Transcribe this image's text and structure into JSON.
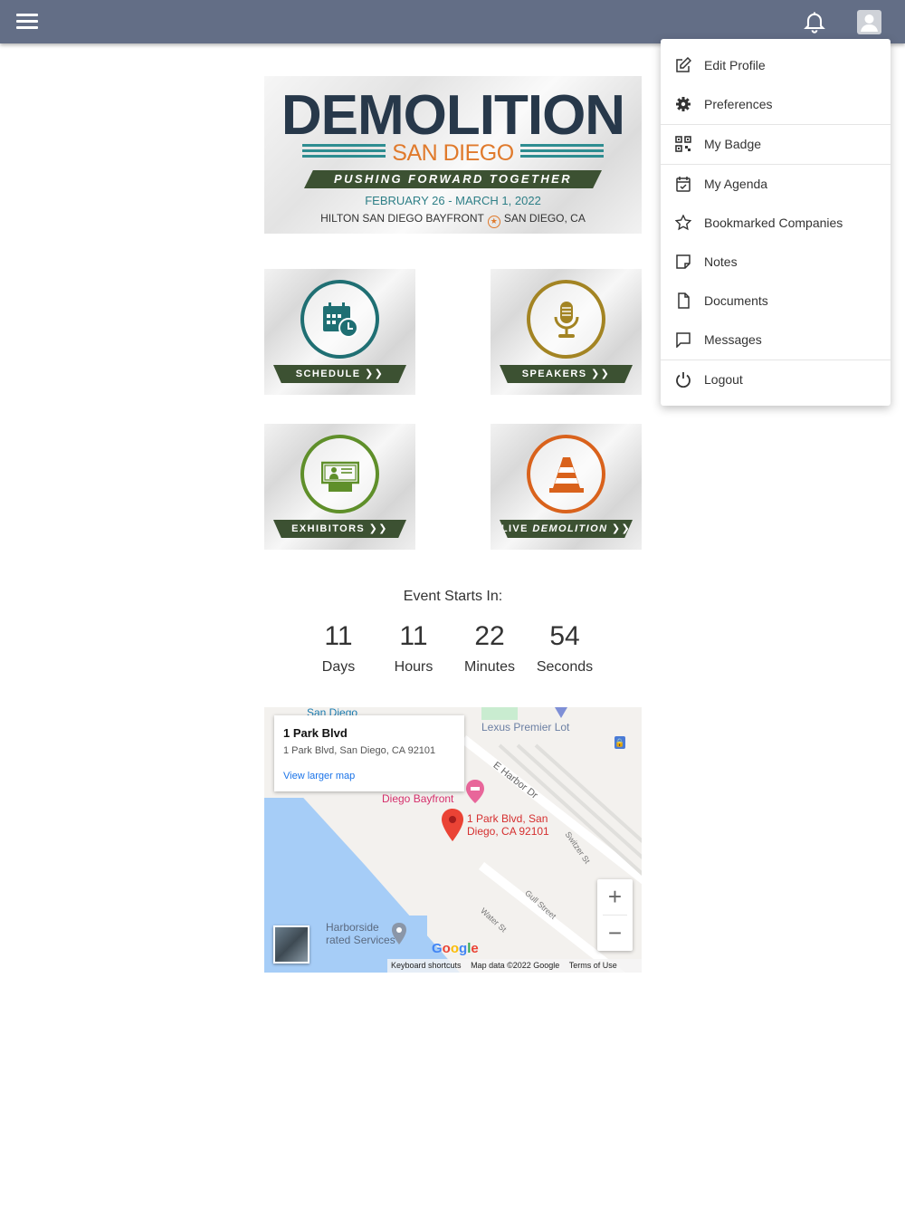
{
  "topbar": {
    "bg_color": "#636e86",
    "menu_icon": "hamburger-icon",
    "bell_icon": "bell-icon",
    "avatar_icon": "user-avatar-icon"
  },
  "banner": {
    "title": "DEMOLITION",
    "subtitle": "SAN DIEGO",
    "tagline": "PUSHING FORWARD TOGETHER",
    "dates": "FEBRUARY 26 - MARCH 1, 2022",
    "venue": "HILTON SAN DIEGO BAYFRONT",
    "city": "SAN DIEGO, CA"
  },
  "tiles": [
    {
      "label": "SCHEDULE",
      "icon": "calendar-clock-icon",
      "color": "#1f6f73"
    },
    {
      "label": "SPEAKERS",
      "icon": "microphone-icon",
      "color": "#a38423"
    },
    {
      "label": "EXHIBITORS",
      "icon": "exhibitor-booth-icon",
      "color": "#5f8f2a"
    },
    {
      "label_prefix": "LIVE ",
      "label_emph": "DEMOLITION",
      "icon": "traffic-cone-icon",
      "color": "#d9621c"
    }
  ],
  "countdown": {
    "title": "Event Starts In:",
    "items": [
      {
        "value": "11",
        "unit": "Days"
      },
      {
        "value": "11",
        "unit": "Hours"
      },
      {
        "value": "22",
        "unit": "Minutes"
      },
      {
        "value": "54",
        "unit": "Seconds"
      }
    ]
  },
  "map": {
    "info_title": "1 Park Blvd",
    "info_address": "1 Park Blvd, San Diego, CA 92101",
    "view_larger": "View larger map",
    "labels": {
      "san_diego": "San Diego",
      "lexus": "Lexus Premier Lot",
      "bayfront": "Diego Bayfront",
      "pin_line1": "1 Park Blvd, San",
      "pin_line2": "Diego, CA 92101",
      "harbor": "E Harbor Dr",
      "switzer": "Switzer St",
      "gull": "Gull Street",
      "water": "Water St",
      "harborside1": "Harborside",
      "harborside2": "rated Services"
    },
    "google": "Google",
    "footer": {
      "shortcuts": "Keyboard shortcuts",
      "mapdata": "Map data ©2022 Google",
      "terms": "Terms of Use"
    },
    "zoom_in": "+",
    "zoom_out": "−"
  },
  "dropdown": {
    "items": [
      {
        "label": "Edit Profile",
        "icon": "edit-icon"
      },
      {
        "label": "Preferences",
        "icon": "gear-icon"
      },
      {
        "label": "My Badge",
        "icon": "qr-code-icon"
      },
      {
        "label": "My Agenda",
        "icon": "calendar-check-icon"
      },
      {
        "label": "Bookmarked Companies",
        "icon": "star-icon"
      },
      {
        "label": "Notes",
        "icon": "note-icon"
      },
      {
        "label": "Documents",
        "icon": "document-icon"
      },
      {
        "label": "Messages",
        "icon": "chat-icon"
      },
      {
        "label": "Logout",
        "icon": "power-icon"
      }
    ]
  }
}
